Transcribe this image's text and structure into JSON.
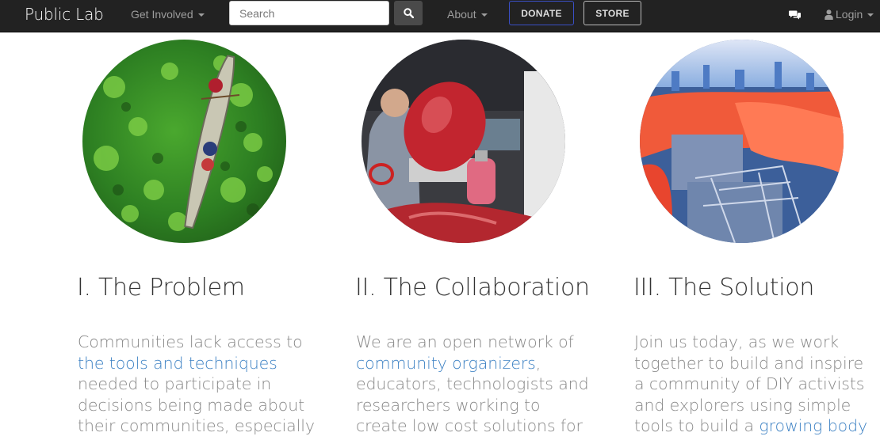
{
  "navbar": {
    "brand": "Public Lab",
    "get_involved": "Get Involved",
    "search_placeholder": "Search",
    "about": "About",
    "donate": "DONATE",
    "store": "STORE",
    "login": "Login"
  },
  "columns": [
    {
      "heading": "I. The Problem",
      "lines": [
        {
          "text": "Communities lack access to",
          "link": ""
        },
        {
          "text": "",
          "link": "the tools and techniques"
        },
        {
          "text": "needed to participate in",
          "link": ""
        },
        {
          "text": "decisions being made about",
          "link": ""
        },
        {
          "text": "their communities, especially",
          "link": ""
        }
      ]
    },
    {
      "heading": "II. The Collaboration",
      "lines": [
        {
          "text": "We are an open network of",
          "link": ""
        },
        {
          "text": ",",
          "link": "community organizers"
        },
        {
          "text": "educators, technologists and",
          "link": ""
        },
        {
          "text": "researchers working to",
          "link": ""
        },
        {
          "text": "create low cost solutions for",
          "link": ""
        }
      ]
    },
    {
      "heading": "III. The Solution",
      "lines": [
        {
          "text": "Join us today, as we work",
          "link": ""
        },
        {
          "text": "together to build and inspire",
          "link": ""
        },
        {
          "text": "a community of DIY activists",
          "link": ""
        },
        {
          "text": "and explorers using simple",
          "link": ""
        },
        {
          "text": "tools to build a ",
          "link": "growing body"
        }
      ]
    }
  ],
  "icons": {
    "search": "search-icon",
    "chat": "comments-icon",
    "user": "user-icon",
    "caret": "chevron-down-icon"
  },
  "colors": {
    "navbar_bg": "#222222",
    "link": "#3e82c4",
    "body_text": "#888888",
    "heading": "#333333",
    "donate_border": "#3a4fc6"
  }
}
